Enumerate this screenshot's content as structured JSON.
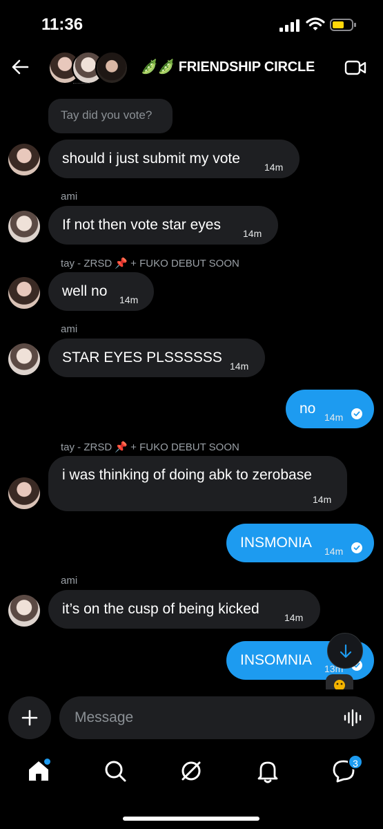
{
  "status_bar": {
    "time": "11:36"
  },
  "header": {
    "title": "🫛🫛 FRIENDSHIP CIRCLE"
  },
  "quoted_message": "Tay did you vote?",
  "messages": [
    {
      "text": "should i just submit my vote",
      "time": "14m"
    },
    {
      "sender": "ami",
      "text": "If not then vote star eyes",
      "time": "14m"
    },
    {
      "sender": "tay - ZRSD 📌 + FUKO DEBUT SOON",
      "text": "well no",
      "time": "14m"
    },
    {
      "sender": "ami",
      "text": "STAR EYES PLSSSSSS",
      "time": "14m"
    },
    {
      "text": "no",
      "time": "14m"
    },
    {
      "sender": "tay - ZRSD 📌 + FUKO DEBUT SOON",
      "text": "i was thinking of doing abk to zerobase",
      "time": "14m"
    },
    {
      "text": "INSMONIA",
      "time": "14m"
    },
    {
      "sender": "ami",
      "text": "it’s on the cusp of being kicked",
      "time": "14m"
    },
    {
      "text": "INSOMNIA",
      "time": "13m"
    }
  ],
  "composer": {
    "placeholder": "Message"
  },
  "tabbar": {
    "messages_badge": "3"
  },
  "colors": {
    "accent": "#1d9bf0",
    "bubble_in": "#1e1f22",
    "background": "#000000"
  }
}
